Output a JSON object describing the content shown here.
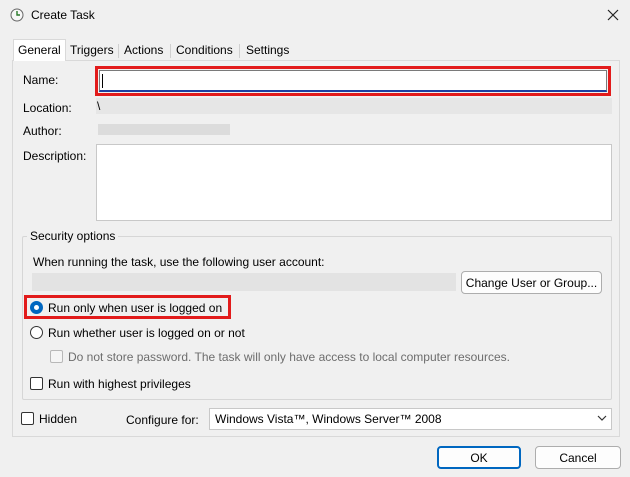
{
  "window": {
    "title": "Create Task"
  },
  "tabs": [
    {
      "label": "General"
    },
    {
      "label": "Triggers"
    },
    {
      "label": "Actions"
    },
    {
      "label": "Conditions"
    },
    {
      "label": "Settings"
    }
  ],
  "general": {
    "name_label": "Name:",
    "name_value": "",
    "location_label": "Location:",
    "location_value": "\\",
    "author_label": "Author:",
    "description_label": "Description:"
  },
  "security": {
    "legend": "Security options",
    "account_prompt": "When running the task, use the following user account:",
    "change_button": "Change User or Group...",
    "run_logged_on": "Run only when user is logged on",
    "run_whether": "Run whether user is logged on or not",
    "no_store_password": "Do not store password.  The task will only have access to local computer resources.",
    "highest_privileges": "Run with highest privileges"
  },
  "bottom": {
    "hidden_label": "Hidden",
    "configure_label": "Configure for:",
    "configure_value": "Windows Vista™, Windows Server™ 2008"
  },
  "buttons": {
    "ok": "OK",
    "cancel": "Cancel"
  },
  "colors": {
    "highlight": "#e21b1b",
    "accent": "#0067c0"
  }
}
